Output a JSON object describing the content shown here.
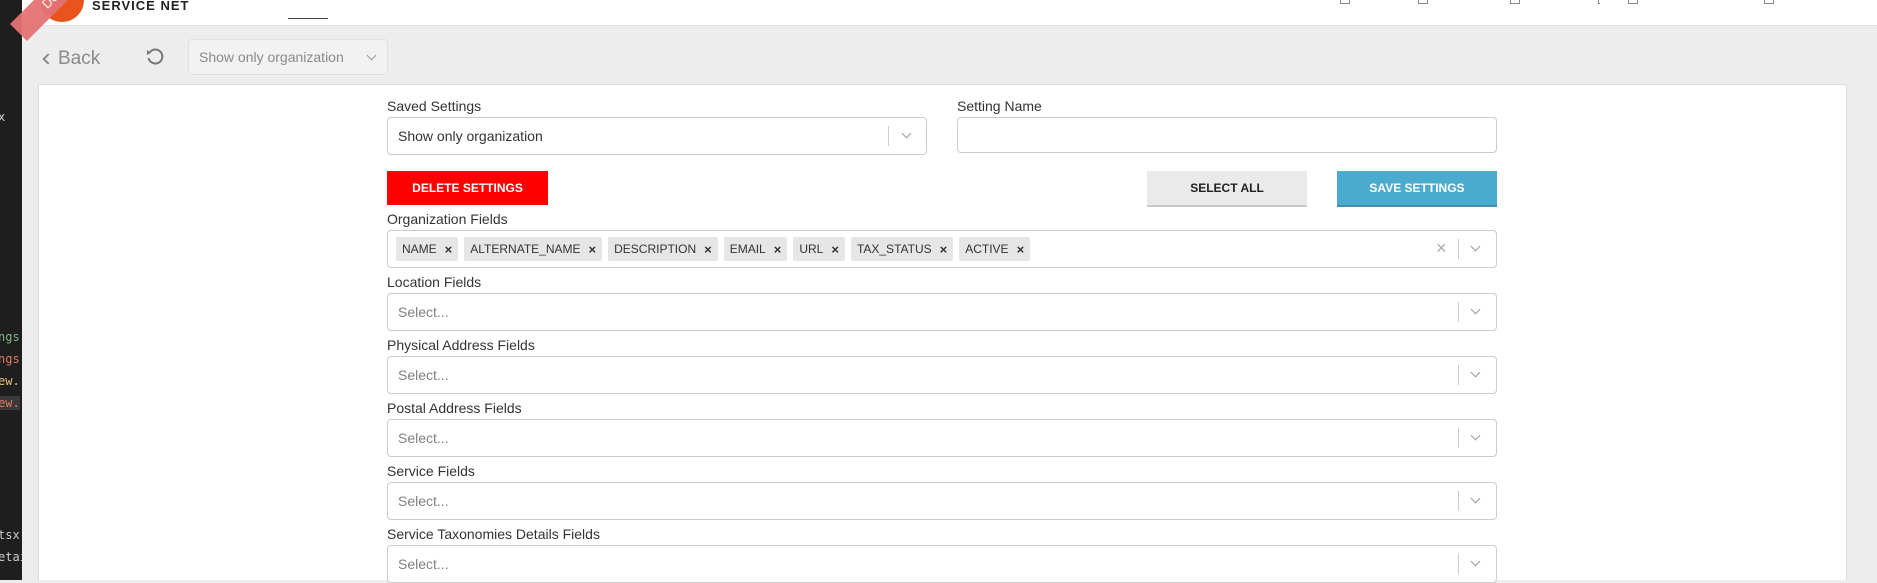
{
  "app": {
    "brand": "SERVICE NET",
    "env_ribbon": "Development"
  },
  "editor_strip": {
    "fragments": [
      "x",
      "ngs",
      "ngs",
      "ew.",
      "ew.",
      "tsx",
      "etai"
    ]
  },
  "toolbar": {
    "back_label": "Back",
    "setting_select_value": "Show only organization"
  },
  "form": {
    "saved_settings_label": "Saved Settings",
    "saved_settings_value": "Show only organization",
    "setting_name_label": "Setting Name",
    "setting_name_value": "",
    "delete_button": "DELETE SETTINGS",
    "select_all_button": "SELECT ALL",
    "save_button": "SAVE SETTINGS",
    "organization_fields": {
      "label": "Organization Fields",
      "selected": [
        "NAME",
        "ALTERNATE_NAME",
        "DESCRIPTION",
        "EMAIL",
        "URL",
        "TAX_STATUS",
        "ACTIVE"
      ]
    },
    "location_fields": {
      "label": "Location Fields",
      "placeholder": "Select..."
    },
    "physical_address_fields": {
      "label": "Physical Address Fields",
      "placeholder": "Select..."
    },
    "postal_address_fields": {
      "label": "Postal Address Fields",
      "placeholder": "Select..."
    },
    "service_fields": {
      "label": "Service Fields",
      "placeholder": "Select..."
    },
    "service_taxonomies_fields": {
      "label": "Service Taxonomies Details Fields",
      "placeholder": "Select..."
    }
  },
  "colors": {
    "delete": "#ff0000",
    "save": "#4aabcf",
    "brand_logo": "#e8541c",
    "ribbon": "#e57373"
  }
}
